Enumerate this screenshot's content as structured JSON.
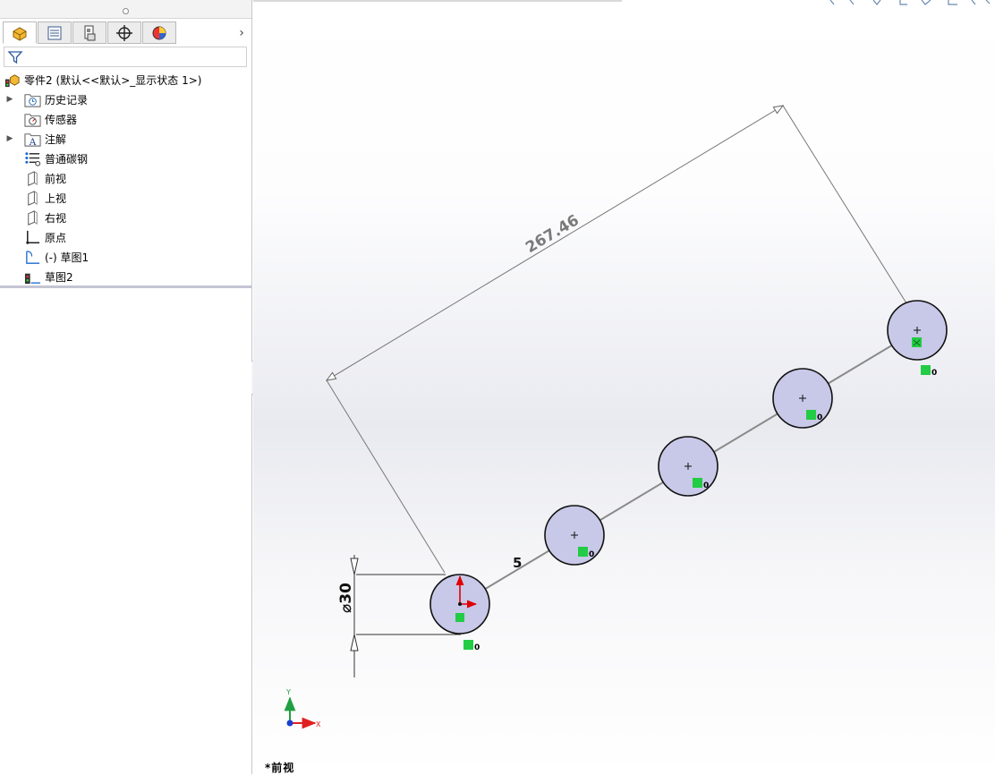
{
  "feature_tree": {
    "root": {
      "label": "零件2  (默认<<默认>_显示状态 1>)",
      "icon": "part-icon"
    },
    "items": [
      {
        "label": "历史记录",
        "icon": "history-folder-icon",
        "expandable": true
      },
      {
        "label": "传感器",
        "icon": "sensor-folder-icon",
        "expandable": false
      },
      {
        "label": "注解",
        "icon": "annotation-icon",
        "expandable": true
      },
      {
        "label": "普通碳钢",
        "icon": "material-icon",
        "expandable": false
      },
      {
        "label": "前视",
        "icon": "plane-icon",
        "expandable": false
      },
      {
        "label": "上视",
        "icon": "plane-icon",
        "expandable": false
      },
      {
        "label": "右视",
        "icon": "plane-icon",
        "expandable": false
      },
      {
        "label": "原点",
        "icon": "origin-icon",
        "expandable": false
      },
      {
        "label": "(-) 草图1",
        "icon": "sketch-icon",
        "expandable": false
      },
      {
        "label": "草图2",
        "icon": "sketch-rollback-icon",
        "expandable": false
      }
    ]
  },
  "tabs": [
    {
      "name": "featuremanager-tab",
      "icon": "feature-manager-icon",
      "active": true
    },
    {
      "name": "propertymanager-tab",
      "icon": "property-manager-icon",
      "active": false
    },
    {
      "name": "configurationmanager-tab",
      "icon": "configuration-manager-icon",
      "active": false
    },
    {
      "name": "dimxpert-tab",
      "icon": "dimxpert-icon",
      "active": false
    },
    {
      "name": "display-manager-tab",
      "icon": "display-manager-icon",
      "active": false
    }
  ],
  "sketch": {
    "dimension_length": "267.46",
    "dimension_diameter": "30",
    "diameter_symbol": "⌀",
    "pattern_count": "5",
    "relation_suffix": "0",
    "circle_count": 5
  },
  "triad": {
    "x_label": "X",
    "y_label": "Y"
  },
  "view_label": "*前视",
  "colors": {
    "circle_fill": "#c8c8e8",
    "relation_green": "#22cc44",
    "origin_red": "#e00000",
    "triad_blue": "#1a3fd0"
  }
}
